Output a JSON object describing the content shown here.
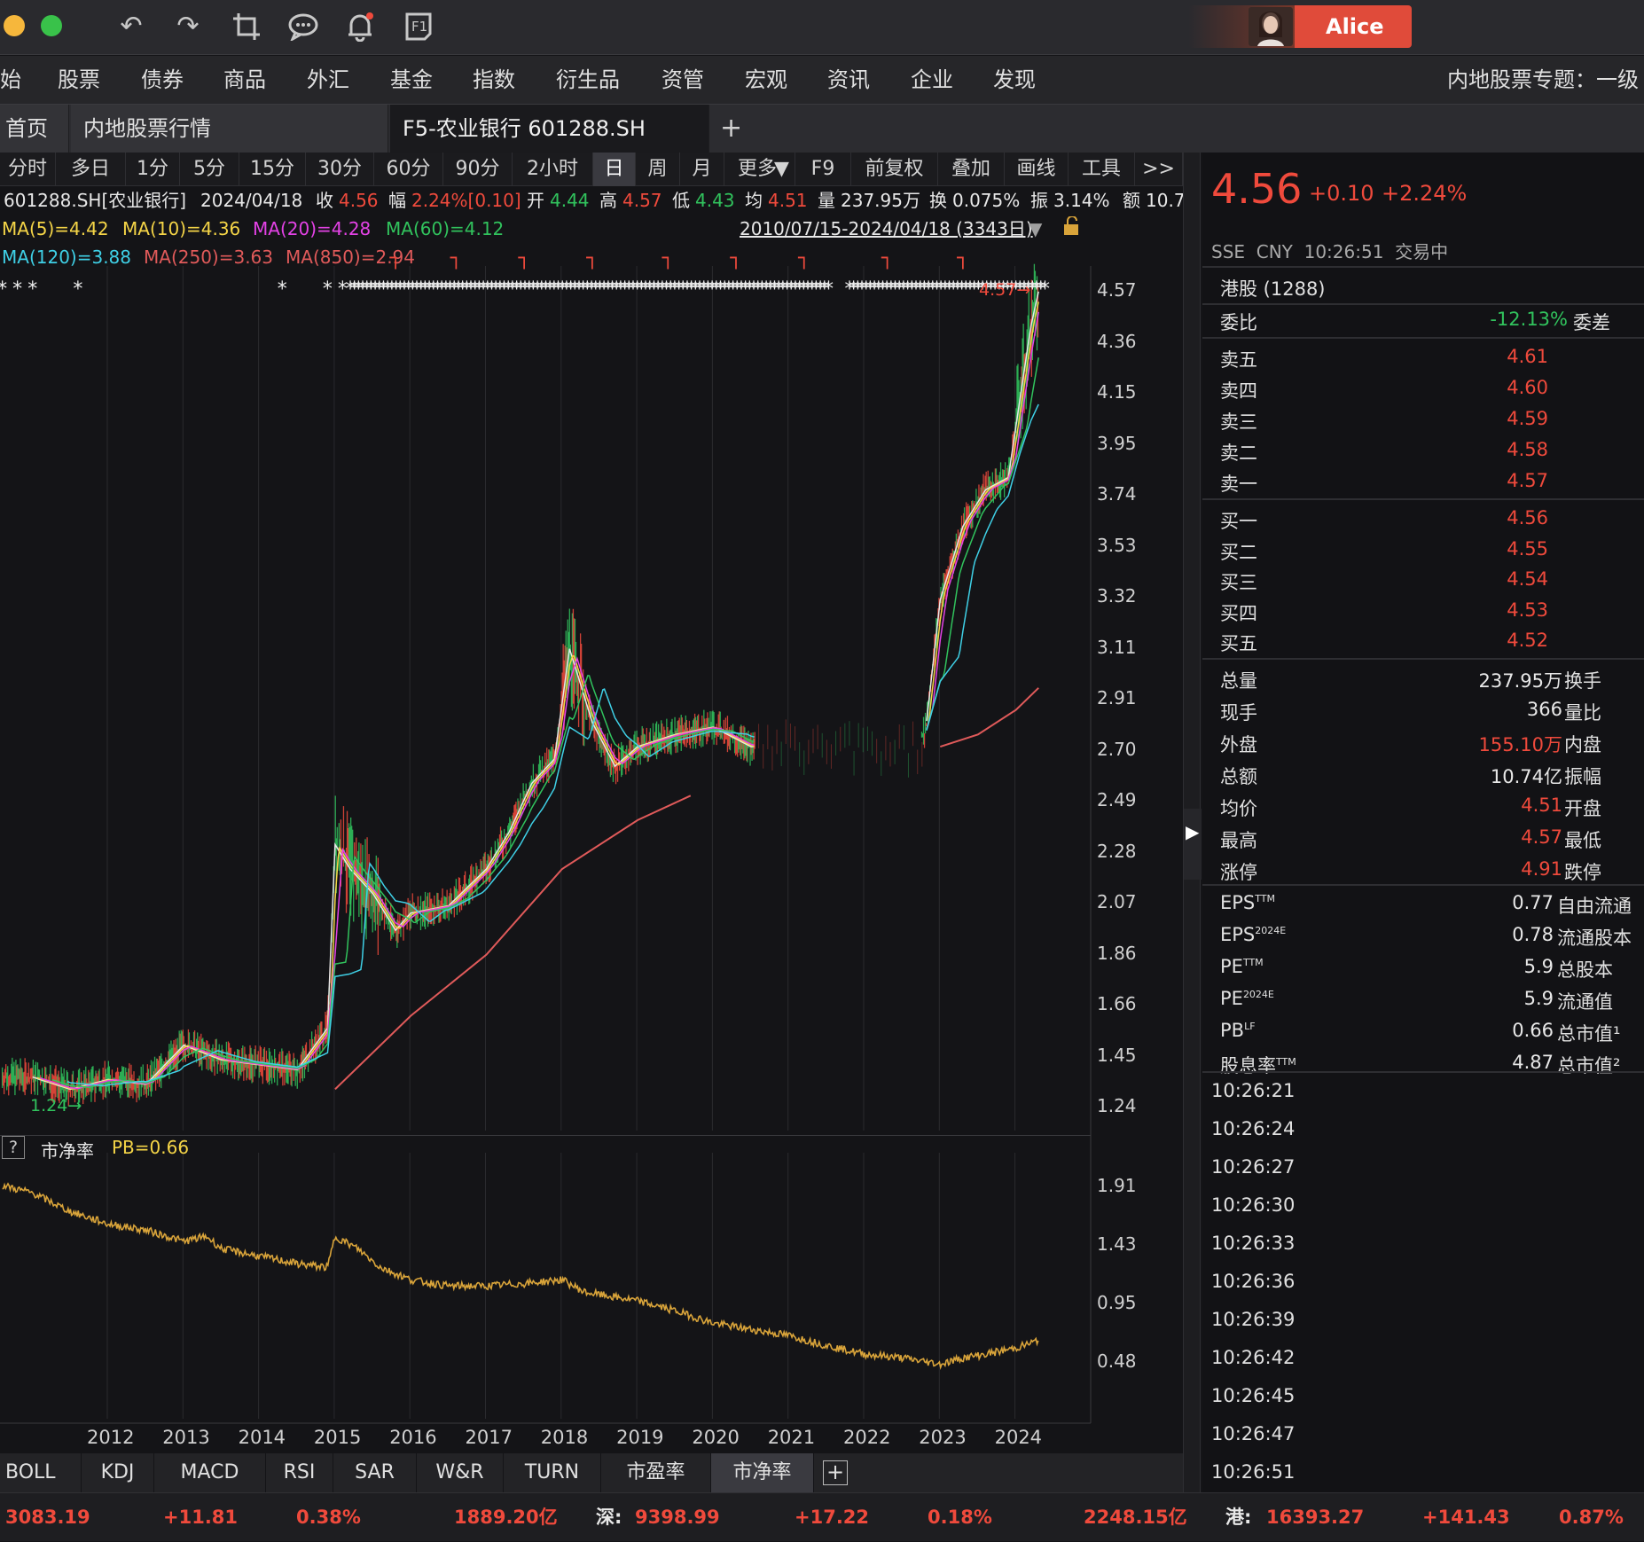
{
  "user": {
    "name": "Alice"
  },
  "menu": [
    "始",
    "股票",
    "债券",
    "商品",
    "外汇",
    "基金",
    "指数",
    "衍生品",
    "资管",
    "宏观",
    "资讯",
    "企业",
    "发现"
  ],
  "menu_right": "内地股票专题：一级",
  "tabs": {
    "home": "首页",
    "market": "内地股票行情",
    "active": "F5-农业银行 601288.SH",
    "add": "+"
  },
  "periods": [
    "分时",
    "多日",
    "1分",
    "5分",
    "15分",
    "30分",
    "60分",
    "90分",
    "2小时",
    "日",
    "周",
    "月",
    "更多",
    "F9",
    "前复权",
    "叠加",
    "画线",
    "工具",
    ">>"
  ],
  "quote": {
    "code": "601288.SH[农业银行]",
    "date": "2024/04/18",
    "close_label": "收",
    "close": "4.56",
    "chg_label": "幅",
    "chg": "2.24%[0.10]",
    "open_label": "开",
    "open": "4.44",
    "high_label": "高",
    "high": "4.57",
    "low_label": "低",
    "low": "4.43",
    "avg_label": "均",
    "avg": "4.51",
    "vol_label": "量",
    "vol": "237.95万",
    "turn_label": "换",
    "turn": "0.075%",
    "amp_label": "振",
    "amp": "3.14%",
    "amt_label": "额",
    "amt": "10.7"
  },
  "ma": {
    "ma5": "MA(5)=4.42",
    "ma10": "MA(10)=4.36",
    "ma20": "MA(20)=4.28",
    "ma60": "MA(60)=4.12",
    "ma120": "MA(120)=3.88",
    "ma250": "MA(250)=3.63",
    "ma850": "MA(850)=2.94",
    "range": "2010/07/15-2024/04/18 (3343日)"
  },
  "annotations": {
    "high": "4.57",
    "low": "1.24"
  },
  "pb_panel": {
    "label": "市净率",
    "value": "PB=0.66"
  },
  "chart_data": [
    {
      "type": "line",
      "title": "601288.SH[农业银行]",
      "xlabel": "",
      "ylabel": "",
      "x_ticks": [
        "2012",
        "2013",
        "2014",
        "2015",
        "2016",
        "2017",
        "2018",
        "2019",
        "2020",
        "2021",
        "2022",
        "2023",
        "2024"
      ],
      "y_ticks": [
        "4.57",
        "4.36",
        "4.15",
        "3.95",
        "3.74",
        "3.53",
        "3.32",
        "3.11",
        "2.91",
        "2.70",
        "2.49",
        "2.28",
        "2.07",
        "1.86",
        "1.66",
        "1.45",
        "1.24"
      ],
      "ylim": [
        1.24,
        4.57
      ],
      "series": [
        {
          "name": "MA(5)",
          "x": [
            2011.0,
            2011.5,
            2012.0,
            2012.5,
            2013.0,
            2013.5,
            2014.0,
            2014.5,
            2014.9,
            2015.0,
            2015.2,
            2015.5,
            2015.8,
            2016.0,
            2016.5,
            2017.0,
            2017.3,
            2017.6,
            2017.9,
            2018.1,
            2018.4,
            2018.7,
            2019.0,
            2019.5,
            2020.0,
            2020.5,
            2022.8,
            2023.0,
            2023.3,
            2023.6,
            2023.9,
            2024.2,
            2024.3
          ],
          "values": [
            1.35,
            1.3,
            1.34,
            1.32,
            1.48,
            1.42,
            1.4,
            1.38,
            1.55,
            2.3,
            2.2,
            2.1,
            1.95,
            2.02,
            2.05,
            2.2,
            2.35,
            2.55,
            2.65,
            3.1,
            2.8,
            2.62,
            2.7,
            2.75,
            2.78,
            2.7,
            2.75,
            3.3,
            3.6,
            3.75,
            3.8,
            4.42,
            4.56
          ]
        },
        {
          "name": "MA(850)",
          "x": [
            2015.0,
            2016.0,
            2017.0,
            2018.0,
            2019.0,
            2019.7
          ],
          "values": [
            1.3,
            1.6,
            1.85,
            2.2,
            2.4,
            2.5
          ]
        },
        {
          "name": "MA(850)",
          "x": [
            2023.0,
            2023.5,
            2024.0,
            2024.3
          ],
          "values": [
            2.7,
            2.75,
            2.85,
            2.94
          ]
        }
      ]
    },
    {
      "type": "line",
      "title": "",
      "x_ticks": [
        "2012",
        "2013",
        "2014",
        "2015",
        "2016",
        "2017",
        "2018",
        "2019",
        "2020",
        "2021",
        "2022",
        "2023",
        "2024"
      ],
      "y_ticks": [
        "1.91",
        "1.43",
        "0.95",
        "0.48"
      ],
      "series": [
        {
          "name": "PB",
          "x": [
            2010.6,
            2011.0,
            2011.5,
            2012.0,
            2012.5,
            2013.0,
            2013.3,
            2013.5,
            2014.0,
            2014.5,
            2014.9,
            2015.0,
            2015.3,
            2015.6,
            2016.0,
            2016.5,
            2017.0,
            2017.5,
            2018.0,
            2018.3,
            2018.6,
            2019.0,
            2019.5,
            2020.0,
            2020.5,
            2021.0,
            2021.5,
            2022.0,
            2022.5,
            2023.0,
            2023.3,
            2023.6,
            2024.0,
            2024.3
          ],
          "values": [
            1.91,
            1.85,
            1.7,
            1.6,
            1.55,
            1.46,
            1.5,
            1.4,
            1.34,
            1.28,
            1.25,
            1.5,
            1.4,
            1.25,
            1.15,
            1.1,
            1.1,
            1.12,
            1.15,
            1.05,
            1.02,
            0.98,
            0.9,
            0.8,
            0.75,
            0.7,
            0.62,
            0.55,
            0.52,
            0.47,
            0.52,
            0.55,
            0.6,
            0.66
          ]
        }
      ]
    }
  ],
  "indicator_tabs": [
    "BOLL",
    "KDJ",
    "MACD",
    "RSI",
    "SAR",
    "W&R",
    "TURN",
    "市盈率",
    "市净率"
  ],
  "right_panel": {
    "price": "4.56",
    "change": "+0.10",
    "change_pct": "+2.24%",
    "meta": "SSE  CNY  10:26:51  交易中",
    "hk": "港股 (1288)",
    "webi_label": "委比",
    "webi": "-12.13%",
    "wecha_label": "委差",
    "asks": [
      {
        "label": "卖五",
        "price": "4.61"
      },
      {
        "label": "卖四",
        "price": "4.60"
      },
      {
        "label": "卖三",
        "price": "4.59"
      },
      {
        "label": "卖二",
        "price": "4.58"
      },
      {
        "label": "卖一",
        "price": "4.57"
      }
    ],
    "bids": [
      {
        "label": "买一",
        "price": "4.56"
      },
      {
        "label": "买二",
        "price": "4.55"
      },
      {
        "label": "买三",
        "price": "4.54"
      },
      {
        "label": "买四",
        "price": "4.53"
      },
      {
        "label": "买五",
        "price": "4.52"
      }
    ],
    "stats": [
      {
        "label": "总量",
        "value": "237.95万",
        "label2": "换手"
      },
      {
        "label": "现手",
        "value": "366",
        "label2": "量比"
      },
      {
        "label": "外盘",
        "value": "155.10万",
        "label2": "内盘"
      },
      {
        "label": "总额",
        "value": "10.74亿",
        "label2": "振幅"
      },
      {
        "label": "均价",
        "value": "4.51",
        "label2": "开盘"
      },
      {
        "label": "最高",
        "value": "4.57",
        "label2": "最低"
      },
      {
        "label": "涨停",
        "value": "4.91",
        "label2": "跌停"
      }
    ],
    "fundamentals": [
      {
        "label": "EPS",
        "sup": "TTM",
        "value": "0.77",
        "label2": "自由流通"
      },
      {
        "label": "EPS",
        "sup": "2024E",
        "value": "0.78",
        "label2": "流通股本"
      },
      {
        "label": "PE",
        "sup": "TTM",
        "value": "5.9",
        "label2": "总股本"
      },
      {
        "label": "PE",
        "sup": "2024E",
        "value": "5.9",
        "label2": "流通值"
      },
      {
        "label": "PB",
        "sup": "LF",
        "value": "0.66",
        "label2": "总市值¹"
      },
      {
        "label": "股息率",
        "sup": "TTM",
        "value": "4.87",
        "label2": "总市值²"
      }
    ],
    "ticks": [
      "10:26:21",
      "10:26:24",
      "10:26:27",
      "10:26:30",
      "10:26:33",
      "10:26:36",
      "10:26:39",
      "10:26:42",
      "10:26:45",
      "10:26:47",
      "10:26:51"
    ]
  },
  "bottom": {
    "sh_index": "3083.19",
    "sh_chg": "+11.81",
    "sh_pct": "0.38%",
    "sh_amt": "1889.20亿",
    "sz_label": "深:",
    "sz_index": "9398.99",
    "sz_chg": "+17.22",
    "sz_pct": "0.18%",
    "sz_amt": "2248.15亿",
    "hk_label": "港:",
    "hk_index": "16393.27",
    "hk_chg": "+141.43",
    "hk_pct": "0.87%"
  },
  "colors": {
    "up": "#ef4a3c",
    "down": "#31c35d",
    "ma5": "#e8e8e8",
    "ma10": "#f5d547",
    "ma20": "#e442e6",
    "ma60": "#31c35d",
    "ma120": "#3fd0e6",
    "ma250": "#e05a5a",
    "pb": "#d9a43a"
  }
}
